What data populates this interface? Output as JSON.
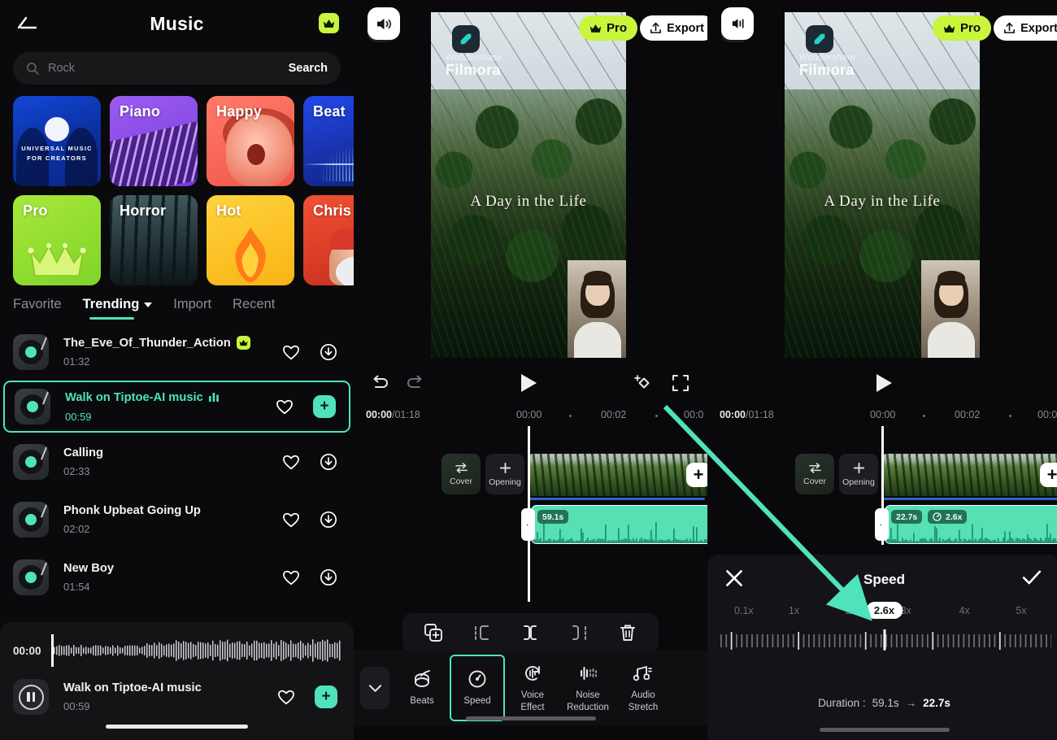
{
  "music_panel": {
    "title": "Music",
    "back_icon": "back-arrow-icon",
    "crown_badge_icon": "crown-icon",
    "search": {
      "value": "",
      "placeholder": "Rock",
      "button_label": "Search",
      "icon": "search-icon"
    },
    "categories": [
      {
        "label": "",
        "brand_line1": "UNIVERSAL MUSIC",
        "brand_line2": "FOR CREATORS",
        "brand": "UNIVERSAL",
        "key": "universal"
      },
      {
        "label": "Piano",
        "key": "piano"
      },
      {
        "label": "Happy",
        "key": "happy"
      },
      {
        "label": "Beat",
        "key": "beat"
      },
      {
        "label": "Pro",
        "key": "pro"
      },
      {
        "label": "Horror",
        "key": "horror"
      },
      {
        "label": "Hot",
        "key": "hot"
      },
      {
        "label": "Chris",
        "key": "chris"
      }
    ],
    "tabs": [
      {
        "label": "Favorite",
        "active": false
      },
      {
        "label": "Trending",
        "active": true,
        "has_caret": true
      },
      {
        "label": "Import",
        "active": false
      },
      {
        "label": "Recent",
        "active": false
      }
    ],
    "tracks": [
      {
        "name": "The_Eve_Of_Thunder_Action",
        "duration": "01:32",
        "pro": true,
        "selected": false,
        "action": "download"
      },
      {
        "name": "Walk on Tiptoe-AI music",
        "duration": "00:59",
        "pro": false,
        "selected": true,
        "action": "add"
      },
      {
        "name": "Calling",
        "duration": "02:33",
        "pro": false,
        "selected": false,
        "action": "download"
      },
      {
        "name": "Phonk Upbeat Going Up",
        "duration": "02:02",
        "pro": false,
        "selected": false,
        "action": "download"
      },
      {
        "name": "New Boy",
        "duration": "01:54",
        "pro": false,
        "selected": false,
        "action": "download"
      }
    ],
    "player": {
      "current_time": "00:00",
      "track_name": "Walk on Tiptoe-AI music",
      "track_duration": "00:59",
      "play_state_icon": "pause-icon",
      "favorite_icon": "heart-icon",
      "add_label": "+"
    }
  },
  "editor_left": {
    "close_icon": "close-icon",
    "pro_label": "Pro",
    "export_label": "Export",
    "watermark_top": "Wondershare",
    "watermark_bottom": "Filmora",
    "video_title": "A Day in the Life",
    "controls": {
      "undo_icon": "undo-icon",
      "redo_icon": "redo-icon",
      "play_icon": "play-icon",
      "keyframe_icon": "keyframe-icon",
      "fullscreen_icon": "fullscreen-icon"
    },
    "timeline": {
      "current_over_total": "00:00/01:18",
      "current": "00:00",
      "total": "01:18",
      "ticks": [
        "00:00",
        "00:02",
        "00:0"
      ],
      "cover_label": "Cover",
      "opening_label": "Opening",
      "add_clip_label": "+",
      "audio_duration_tag": "59.1s"
    },
    "action_icons": [
      "copy-add-icon",
      "split-left-icon",
      "split-icon",
      "split-right-icon",
      "delete-icon"
    ],
    "tools": [
      {
        "label": "Beats",
        "icon": "beats-icon",
        "active": false
      },
      {
        "label": "Speed",
        "icon": "speed-icon",
        "active": true
      },
      {
        "label": "Voice\nEffect",
        "label_l1": "Voice",
        "label_l2": "Effect",
        "icon": "voice-effect-icon",
        "active": false
      },
      {
        "label": "Noise Reduction",
        "label_l1": "Noise",
        "label_l2": "Reduction",
        "icon": "noise-reduction-icon",
        "active": false
      },
      {
        "label": "Audio Stretch",
        "label_l1": "Audio",
        "label_l2": "Stretch",
        "icon": "audio-stretch-icon",
        "active": false
      }
    ],
    "collapse_icon": "chevron-down-icon"
  },
  "editor_right": {
    "close_icon": "close-icon",
    "pro_label": "Pro",
    "export_label": "Export",
    "watermark_top": "Wondershare",
    "watermark_bottom": "Filmora",
    "video_title": "A Day in the Life",
    "play_icon": "play-icon",
    "timeline": {
      "current_over_total": "00:00/01:18",
      "ticks": [
        "00:00",
        "00:02",
        "00:0"
      ],
      "cover_label": "Cover",
      "opening_label": "Opening",
      "add_clip_label": "+",
      "audio_duration_tag": "22.7s",
      "speed_tag": "2.6x"
    },
    "speed_sheet": {
      "title": "Speed",
      "close_icon": "close-icon",
      "confirm_icon": "check-icon",
      "scale_labels": [
        "0.1x",
        "1x",
        "2x",
        "3x",
        "4x",
        "5x"
      ],
      "current_value": "2.6x",
      "duration_label": "Duration :",
      "duration_from": "59.1s",
      "duration_to": "22.7s",
      "arrow_glyph": "→"
    }
  },
  "colors": {
    "accent_teal": "#4fe3bc",
    "pro_lime": "#c9f53c",
    "panel_bg": "#09090b",
    "sheet_bg": "#131318",
    "annotation_arrow": "#4fe3bc"
  }
}
